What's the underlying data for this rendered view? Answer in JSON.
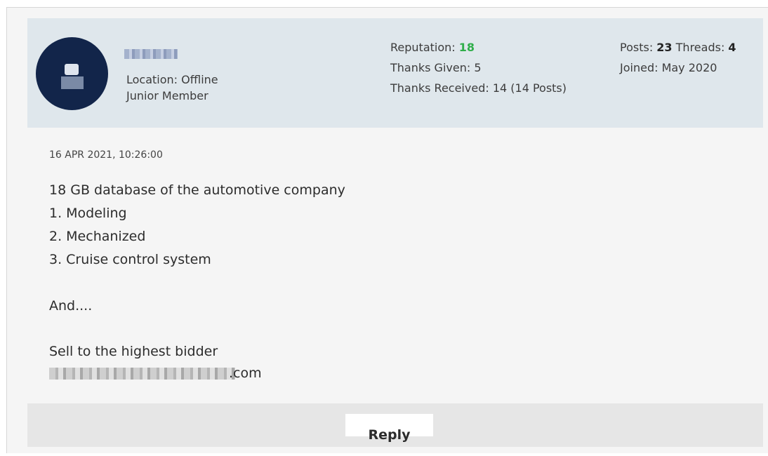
{
  "user": {
    "location_label": "Location: Offline",
    "rank": "Junior Member"
  },
  "stats": {
    "reputation_label": "Reputation:",
    "reputation_value": "18",
    "thanks_given": "Thanks Given: 5",
    "thanks_received": "Thanks Received: 14 (14 Posts)",
    "posts_label": "Posts:",
    "posts_value": "23",
    "threads_label": "Threads:",
    "threads_value": "4",
    "joined": "Joined: May 2020"
  },
  "post": {
    "date": "16 APR 2021, 10:26:00",
    "lines": [
      "18 GB database of the automotive company",
      "1. Modeling",
      "2. Mechanized",
      "3. Cruise control system",
      "And....",
      "Sell to the highest bidder"
    ],
    "email_suffix": ".com"
  },
  "footer": {
    "reply_label": "Reply"
  },
  "colors": {
    "header_bg": "#dfe7ec",
    "reputation_green": "#2fae4a",
    "avatar_navy": "#12254a"
  }
}
